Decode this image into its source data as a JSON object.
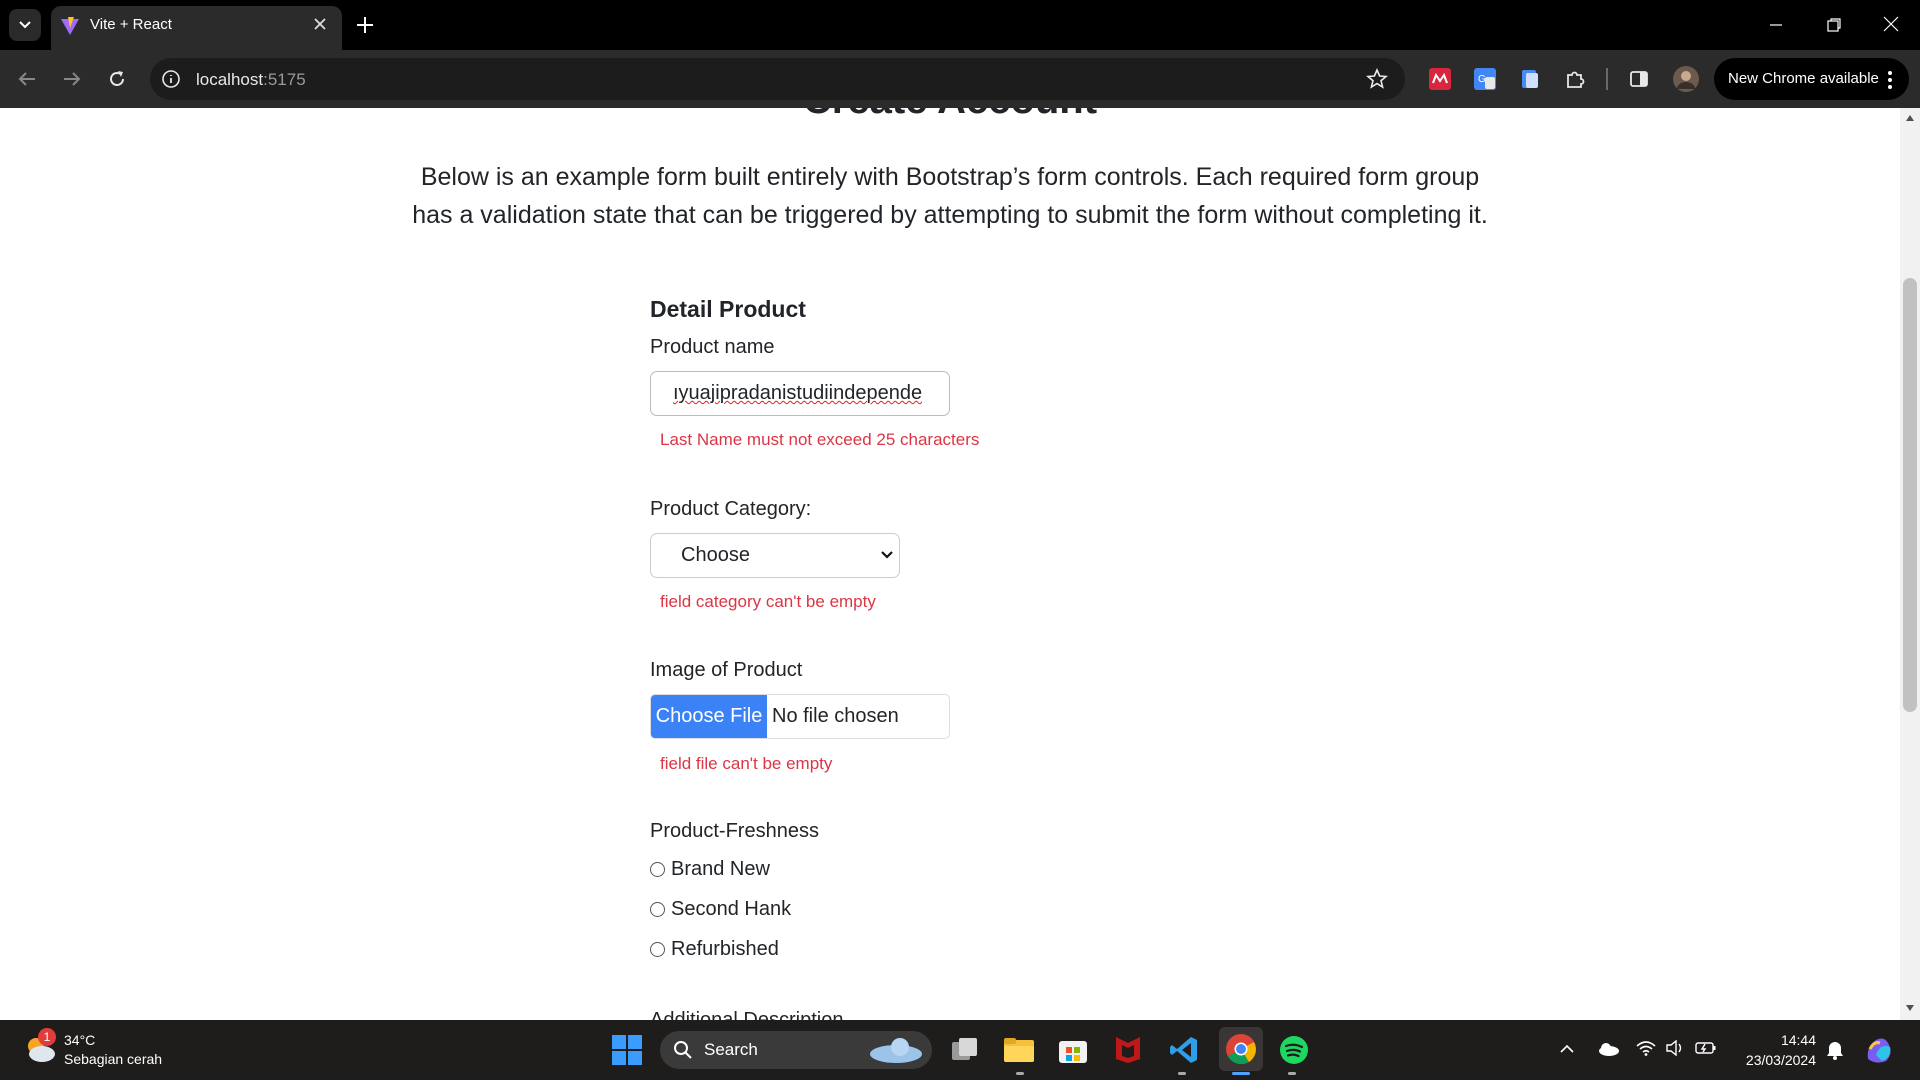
{
  "browser": {
    "tab_title": "Vite + React",
    "url_host": "localhost",
    "url_port": ":5175",
    "update_button": "New Chrome available"
  },
  "page": {
    "heading": "Create Account",
    "lead": "Below is an example form built entirely with Bootstrap’s form controls. Each required form group has a validation state that can be triggered by attempting to submit the form without completing it."
  },
  "form": {
    "section_title": "Detail Product",
    "product_name": {
      "label": "Product name",
      "value": "ıyuajipradanistudiindepende",
      "error": "Last Name must not exceed 25 characters"
    },
    "category": {
      "label": "Product Category:",
      "selected": "Choose",
      "error": "field category can't be empty"
    },
    "image": {
      "label": "Image of Product",
      "button": "Choose File",
      "status": "No file chosen",
      "error": "field file can't be empty"
    },
    "freshness": {
      "label": "Product-Freshness",
      "options": [
        "Brand New",
        "Second Hank",
        "Refurbished"
      ]
    },
    "description": {
      "label": "Additional Description"
    }
  },
  "taskbar": {
    "weather_temp": "34°C",
    "weather_desc": "Sebagian cerah",
    "weather_badge": "1",
    "search_label": "Search",
    "time": "14:44",
    "date": "23/03/2024"
  },
  "colors": {
    "error": "#dc3545",
    "file_button": "#3b82f6"
  }
}
